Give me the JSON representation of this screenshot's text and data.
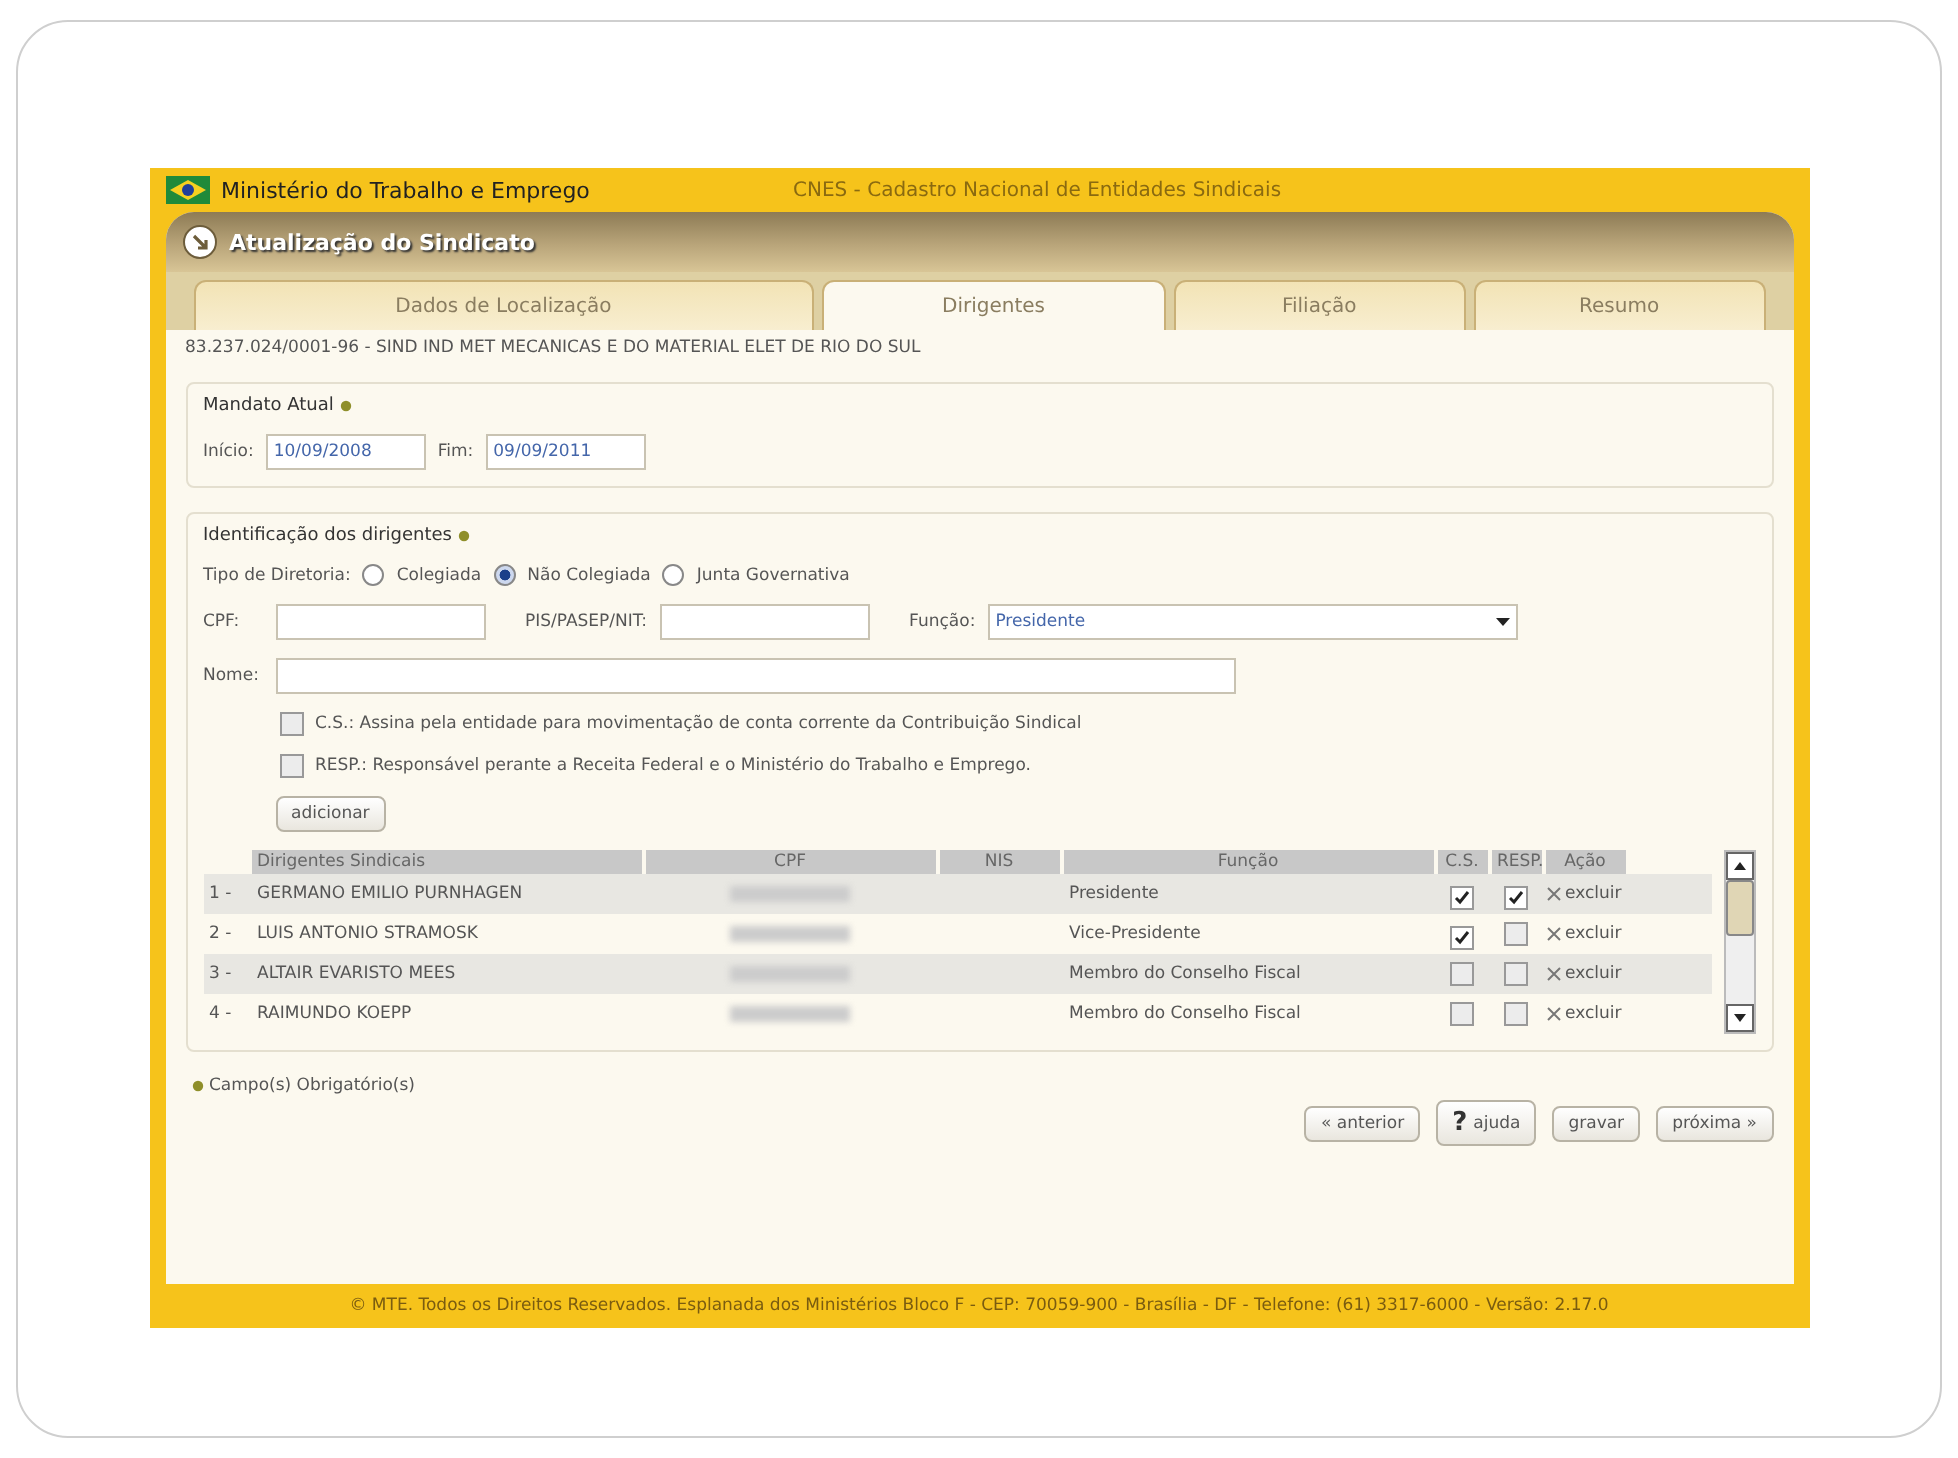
{
  "top_bar": {
    "ministry": "Ministério do Trabalho e Emprego",
    "system": "CNES - Cadastro Nacional de Entidades Sindicais"
  },
  "header": {
    "title": "Atualização do Sindicato"
  },
  "tabs": [
    {
      "label": "Dados de Localização",
      "selected": false
    },
    {
      "label": "Dirigentes",
      "selected": true
    },
    {
      "label": "Filiação",
      "selected": false
    },
    {
      "label": "Resumo",
      "selected": false
    }
  ],
  "entity": "83.237.024/0001-96 - SIND IND MET MECANICAS E DO MATERIAL ELET DE RIO DO SUL",
  "mandate": {
    "legend": "Mandato Atual",
    "start_label": "Início:",
    "start": "10/09/2008",
    "end_label": "Fim:",
    "end": "09/09/2011"
  },
  "leaders_form": {
    "legend": "Identificação dos dirigentes",
    "type_label": "Tipo de Diretoria:",
    "types": [
      {
        "label": "Colegiada",
        "selected": false
      },
      {
        "label": "Não Colegiada",
        "selected": true
      },
      {
        "label": "Junta Governativa",
        "selected": false
      }
    ],
    "cpf_label": "CPF:",
    "pis_label": "PIS/PASEP/NIT:",
    "function_label": "Função:",
    "function_value": "Presidente",
    "name_label": "Nome:",
    "options": [
      {
        "label": "C.S.: Assina pela entidade para movimentação de conta corrente da Contribuição Sindical",
        "checked": false
      },
      {
        "label": "RESP.: Responsável perante a Receita Federal e o Ministério do Trabalho e Emprego.",
        "checked": false
      }
    ],
    "add_button": "adicionar"
  },
  "table": {
    "columns": [
      "Dirigentes Sindicais",
      "CPF",
      "NIS",
      "Função",
      "C.S.",
      "RESP.",
      "Ação"
    ],
    "rows": [
      {
        "index": "1 -",
        "name": "GERMANO EMILIO PURNHAGEN",
        "function": "Presidente",
        "cs": true,
        "resp": true,
        "action": "excluir"
      },
      {
        "index": "2 -",
        "name": "LUIS ANTONIO STRAMOSK",
        "function": "Vice-Presidente",
        "cs": true,
        "resp": false,
        "action": "excluir"
      },
      {
        "index": "3 -",
        "name": "ALTAIR EVARISTO MEES",
        "function": "Membro do Conselho Fiscal",
        "cs": false,
        "resp": false,
        "action": "excluir"
      },
      {
        "index": "4 -",
        "name": "RAIMUNDO KOEPP",
        "function": "Membro do Conselho Fiscal",
        "cs": false,
        "resp": false,
        "action": "excluir"
      }
    ]
  },
  "required_note": "Campo(s) Obrigatório(s)",
  "buttons": [
    {
      "kind": "plain",
      "label": "« anterior"
    },
    {
      "kind": "help",
      "icon": "?",
      "label": "ajuda"
    },
    {
      "kind": "plain",
      "label": "gravar"
    },
    {
      "kind": "plain",
      "label": "próxima »"
    }
  ],
  "footer": "© MTE. Todos os Direitos Reservados. Esplanada dos Ministérios Bloco F - CEP: 70059-900 - Brasília - DF - Telefone: (61) 3317-6000 - Versão: 2.17.0"
}
